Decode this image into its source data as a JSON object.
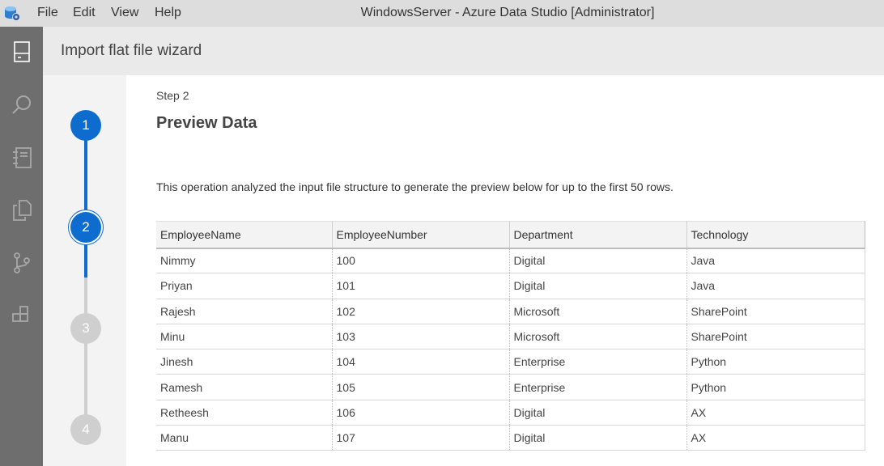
{
  "titlebar": {
    "menu": [
      "File",
      "Edit",
      "View",
      "Help"
    ],
    "window_title": "WindowsServer - Azure Data Studio [Administrator]"
  },
  "activity_bar": {
    "icons": [
      "servers-icon",
      "search-icon",
      "notebook-icon",
      "explorer-icon",
      "source-control-icon",
      "extensions-icon"
    ]
  },
  "dialog": {
    "title": "Import flat file wizard"
  },
  "steps": {
    "items": [
      "1",
      "2",
      "3",
      "4"
    ],
    "current": 2
  },
  "main": {
    "step_label": "Step 2",
    "heading": "Preview Data",
    "description": "This operation analyzed the input file structure to generate the preview below for up to the first 50 rows."
  },
  "table": {
    "columns": [
      "EmployeeName",
      "EmployeeNumber",
      "Department",
      "Technology"
    ],
    "rows": [
      [
        "Nimmy",
        "100",
        "Digital",
        "Java"
      ],
      [
        "Priyan",
        "101",
        "Digital",
        "Java"
      ],
      [
        "Rajesh",
        "102",
        "Microsoft",
        "SharePoint"
      ],
      [
        "Minu",
        "103",
        "Microsoft",
        "SharePoint"
      ],
      [
        "Jinesh",
        "104",
        "Enterprise",
        "Python"
      ],
      [
        "Ramesh",
        "105",
        "Enterprise",
        "Python"
      ],
      [
        "Retheesh",
        "106",
        "Digital",
        "AX"
      ],
      [
        "Manu",
        "107",
        "Digital",
        "AX"
      ]
    ]
  },
  "colors": {
    "accent": "#0e6ccf",
    "activity_bar": "#6e6e6e",
    "step_inactive": "#cfcfcf"
  }
}
